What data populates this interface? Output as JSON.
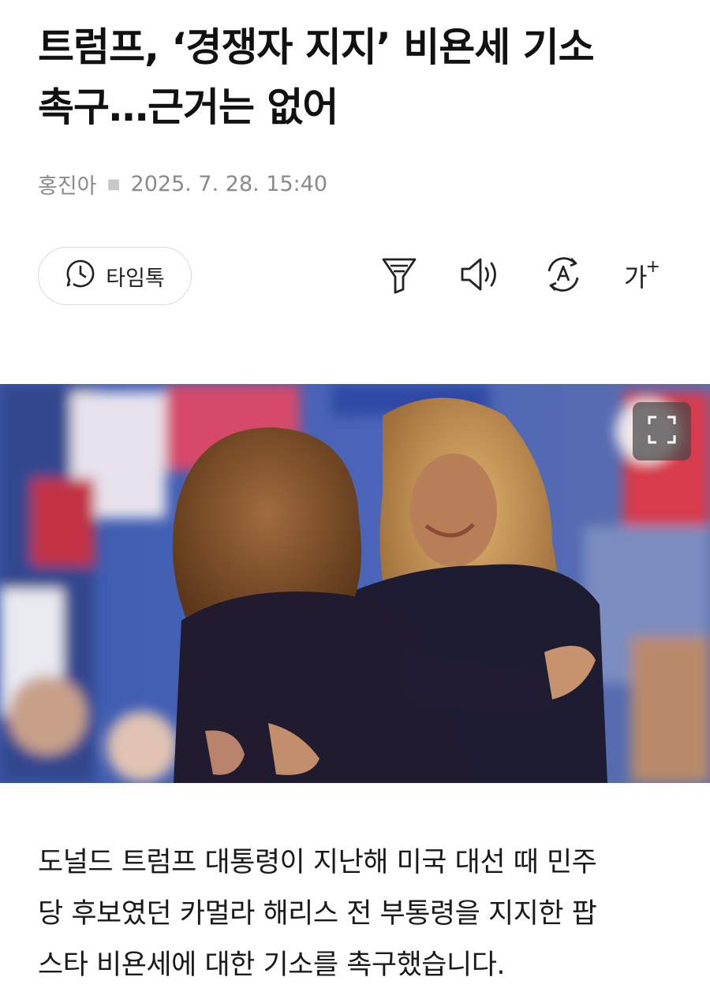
{
  "article": {
    "title_line1": "트럼프, ‘경쟁자 지지’ 비욘세 기소",
    "title_line2": "촉구…근거는 없어",
    "author": "홍진아",
    "datetime": "2025. 7. 28. 15:40",
    "body_line1": "도널드 트럼프 대통령이 지난해 미국 대선 때 민주",
    "body_line2": "당 후보였던 카멀라 해리스 전 부통령을 지지한 팝",
    "body_line3": "스타 비욘세에 대한 기소를 촉구했습니다."
  },
  "toolbar": {
    "timetalk_label": "타임톡",
    "timetalk_icon": "clock-chat-icon",
    "filter_icon": "filter-icon",
    "speaker_icon": "speaker-icon",
    "translate_icon": "translate-icon",
    "fontsize_label": "가",
    "fontsize_plus": "+"
  },
  "photo": {
    "expand_icon": "fullscreen-icon"
  }
}
